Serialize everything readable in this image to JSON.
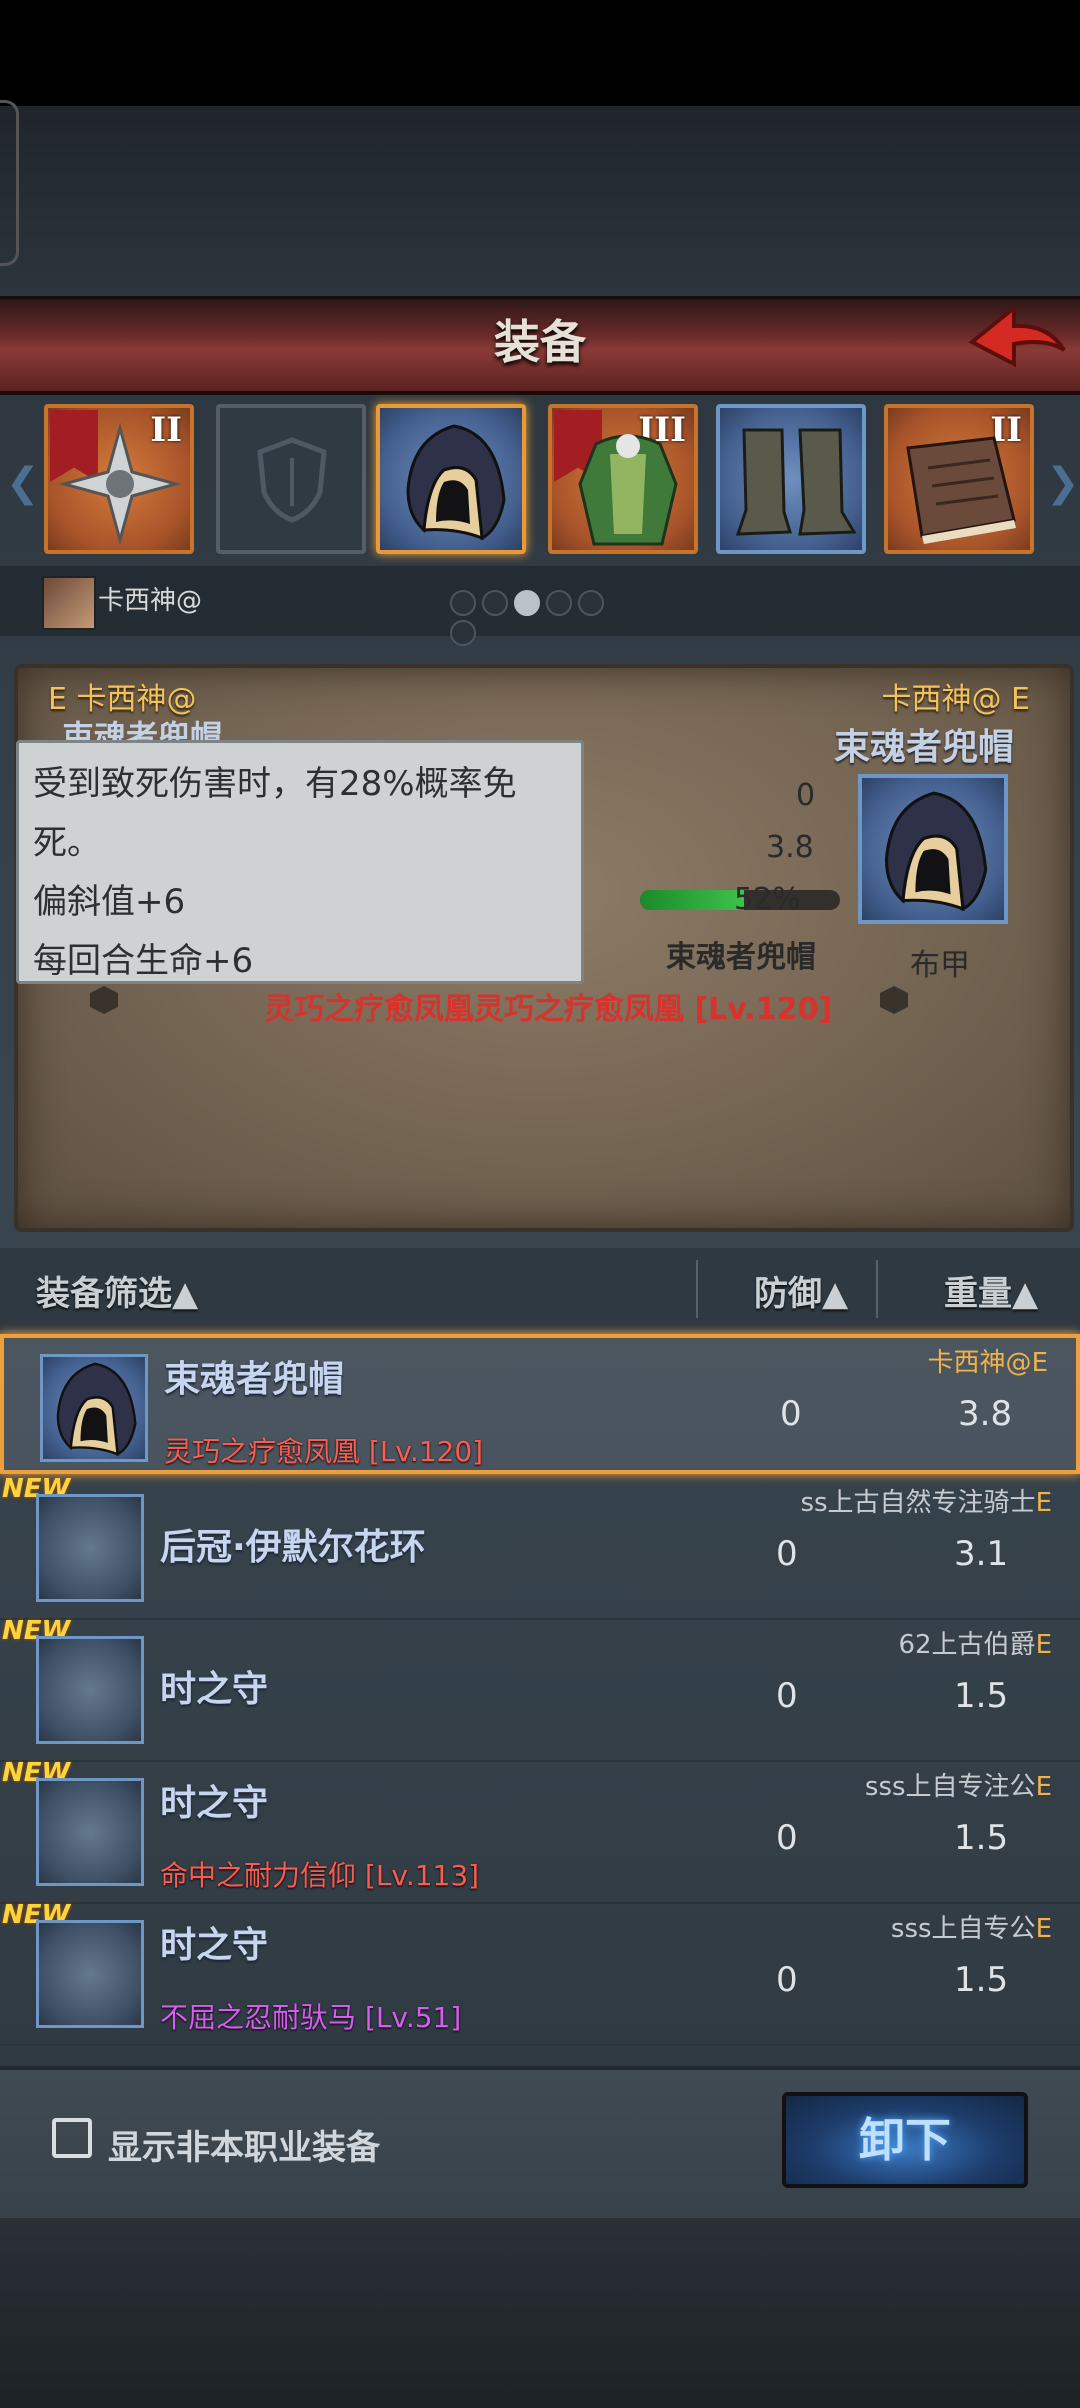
{
  "title": "装备",
  "slots": [
    {
      "id": "weapon",
      "tier": "II",
      "tier_flag": true
    },
    {
      "id": "shield",
      "tier": "",
      "tier_flag": false
    },
    {
      "id": "helmet",
      "tier": "",
      "tier_flag": false
    },
    {
      "id": "armor",
      "tier": "III",
      "tier_flag": true
    },
    {
      "id": "boots",
      "tier": "",
      "tier_flag": false
    },
    {
      "id": "book",
      "tier": "II",
      "tier_flag": false
    }
  ],
  "character": {
    "name": "卡西神@"
  },
  "pager": {
    "count": 6,
    "active": 2
  },
  "compare": {
    "left_header": "E 卡西神@",
    "left_item_partial": "束魂者兜帽",
    "right_header": "卡西神@ E",
    "right_item": "束魂者兜帽",
    "defense": "0",
    "weight": "3.8",
    "durability_percent": 52,
    "durability_label": "52%",
    "item_name2": "束魂者兜帽",
    "enchant": "灵巧之疗愈凤凰灵巧之疗愈凤凰 [Lv.120]",
    "armor_type": "布甲"
  },
  "tooltip": {
    "line1": "受到致死伤害时，有28%概率免",
    "line2": "死。",
    "line3": "偏斜值+6",
    "line4": "每回合生命+6"
  },
  "filter_header": {
    "filter": "装备筛选▲",
    "defense": "防御▲",
    "weight": "重量▲"
  },
  "list": [
    {
      "name": "束魂者兜帽",
      "sub": "灵巧之疗愈凤凰 [Lv.120]",
      "sub_color": "#ff5a4f",
      "owner": "卡西神@",
      "owner_tag": "E",
      "defense": "0",
      "weight": "3.8",
      "new": false,
      "selected": true
    },
    {
      "name": "后冠·伊默尔花环",
      "sub": "",
      "sub_color": "",
      "owner": "ss上古自然专注骑士",
      "owner_tag": "E",
      "defense": "0",
      "weight": "3.1",
      "new": true,
      "selected": false
    },
    {
      "name": "时之守",
      "sub": "",
      "sub_color": "",
      "owner": "62上古伯爵",
      "owner_tag": "E",
      "defense": "0",
      "weight": "1.5",
      "new": true,
      "selected": false
    },
    {
      "name": "时之守",
      "sub": "命中之耐力信仰 [Lv.113]",
      "sub_color": "#ff5a4f",
      "owner": "sss上自专注公",
      "owner_tag": "E",
      "defense": "0",
      "weight": "1.5",
      "new": true,
      "selected": false
    },
    {
      "name": "时之守",
      "sub": "不屈之忍耐驮马 [Lv.51]",
      "sub_color": "#d95cf0",
      "owner": "sss上自专公",
      "owner_tag": "E",
      "defense": "0",
      "weight": "1.5",
      "new": true,
      "selected": false
    }
  ],
  "new_label": "NEW",
  "bottom": {
    "checkbox_label": "显示非本职业装备",
    "unequip_label": "卸下",
    "checked": false
  },
  "colors": {
    "accent_gold": "#f2c25c",
    "title_red": "#8a3a36",
    "button_blue": "#3a78c2"
  }
}
